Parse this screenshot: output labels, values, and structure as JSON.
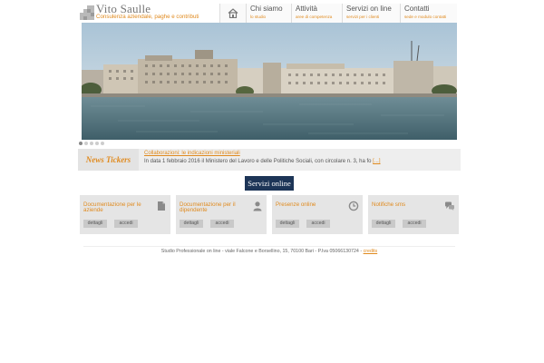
{
  "header": {
    "title": "Vito Saulle",
    "subtitle": "Consulenza aziendale, paghe e contributi"
  },
  "nav": {
    "home_icon": "home-icon",
    "items": [
      {
        "title": "Chi siamo",
        "sub": "lo studio"
      },
      {
        "title": "Attività",
        "sub": "aree di competenza"
      },
      {
        "title": "Servizi on line",
        "sub": "servizi per i clienti"
      },
      {
        "title": "Contatti",
        "sub": "sede e modulo contatti"
      }
    ]
  },
  "ticker": {
    "label": "News Tickers",
    "title": "Collaborazioni: le indicazioni ministeriali",
    "text": "In data 1 febbraio 2016 il Ministero del Lavoro e delle Politiche Sociali, con circolare n. 3, ha fo",
    "more": "[...]"
  },
  "services": {
    "button": "Servizi online",
    "cards": [
      {
        "title": "Documentazione per le aziende",
        "icon": "document-icon",
        "btn1": "dettagli",
        "btn2": "accedi"
      },
      {
        "title": "Documentazione per il dipendente",
        "icon": "user-icon",
        "btn1": "dettagli",
        "btn2": "accedi"
      },
      {
        "title": "Presenze online",
        "icon": "clock-icon",
        "btn1": "dettagli",
        "btn2": "accedi"
      },
      {
        "title": "Notifiche sms",
        "icon": "chat-icon",
        "btn1": "dettagli",
        "btn2": "accedi"
      }
    ]
  },
  "footer": {
    "text": "Studio Professionale on line - viale Falcone e Borsellino, 15, 70100 Bari - P.Iva 05066130724 - ",
    "link": "credits"
  },
  "colors": {
    "accent": "#e08a1e",
    "button": "#1d3557"
  }
}
